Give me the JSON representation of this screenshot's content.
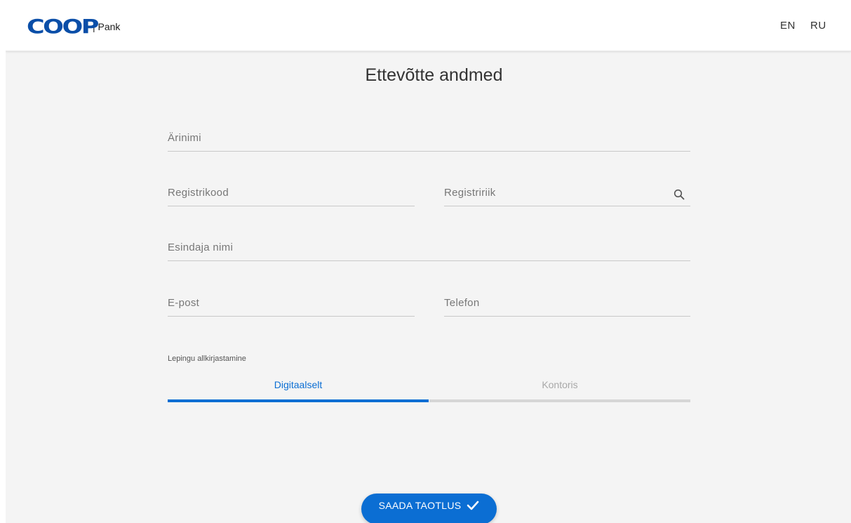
{
  "header": {
    "logo_text": "COOP",
    "logo_suffix": "| Pank",
    "languages": [
      "EN",
      "RU"
    ]
  },
  "form": {
    "title": "Ettevõtte andmed",
    "fields": {
      "business_name": {
        "placeholder": "Ärinimi",
        "value": ""
      },
      "registry_code": {
        "placeholder": "Registrikood",
        "value": ""
      },
      "registry_country": {
        "placeholder": "Registririik",
        "value": "",
        "icon": "search-icon"
      },
      "representative_name": {
        "placeholder": "Esindaja nimi",
        "value": ""
      },
      "email": {
        "placeholder": "E-post",
        "value": ""
      },
      "phone": {
        "placeholder": "Telefon",
        "value": ""
      }
    },
    "signing": {
      "label": "Lepingu allkirjastamine",
      "options": [
        "Digitaalselt",
        "Kontoris"
      ],
      "selected": "Digitaalselt"
    },
    "submit_label": "SAADA TAOTLUS",
    "submit_icon": "check-icon"
  },
  "colors": {
    "brand": "#0a4ea8",
    "accent": "#0b6ed3",
    "background": "#f4f4f4",
    "inactive_tab": "#a8a8a8"
  }
}
